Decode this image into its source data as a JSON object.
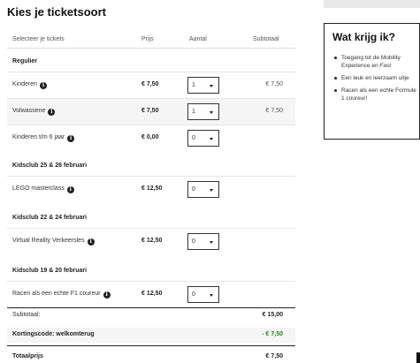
{
  "page": {
    "title": "Kies je ticketsoort"
  },
  "table": {
    "headers": {
      "tickets": "Selecteer je tickets",
      "price": "Prijs",
      "qty": "Aantal",
      "subtotal": "Subtotaal"
    },
    "sections": [
      {
        "title": "Regulier",
        "rows": [
          {
            "name": "Kinderen",
            "price": "€ 7,50",
            "qty": "1",
            "subtotal": "€ 7,50"
          },
          {
            "name": "Volwassene",
            "price": "€ 7,50",
            "qty": "1",
            "subtotal": "€ 7,50"
          },
          {
            "name": "Kinderen t/m 6 jaar",
            "price": "€ 0,00",
            "qty": "0",
            "subtotal": ""
          }
        ]
      },
      {
        "title": "Kidsclub 25 & 26 februari",
        "rows": [
          {
            "name": "LEGO masterclass",
            "price": "€ 12,50",
            "qty": "0",
            "subtotal": ""
          }
        ]
      },
      {
        "title": "Kidsclub 22 & 24 februari",
        "rows": [
          {
            "name": "Virtual Reality Verkeersles",
            "price": "€ 12,50",
            "qty": "0",
            "subtotal": ""
          }
        ]
      },
      {
        "title": "Kidsclub 19 & 20 februari",
        "rows": [
          {
            "name": "Racen als een echte F1 coureur",
            "price": "€ 12,50",
            "qty": "0",
            "subtotal": ""
          }
        ]
      }
    ],
    "totals": {
      "subtotal_label": "Subtotaal:",
      "subtotal_value": "€ 15,00",
      "discount_label": "Kortingscode: welkomterug",
      "discount_value": "- € 7,50",
      "total_label": "Totaalprijs",
      "total_value": "€ 7,50"
    }
  },
  "sidebar": {
    "title": "Wat krijg ik?",
    "items": [
      {
        "text": "Toegang tot de Mobility Experience en ",
        "em": "Fast"
      },
      {
        "text": "Een leuk en leerzaam uitje",
        "em": ""
      },
      {
        "text": "Racen als een echte Formule 1 coureur!",
        "em": ""
      }
    ]
  },
  "colors": {
    "discount": "#1f8a1f",
    "border": "#222222",
    "row_shade": "#f5f5f5"
  },
  "icons": {
    "info": "info-circle-icon",
    "dropdown": "caret-down-icon"
  }
}
